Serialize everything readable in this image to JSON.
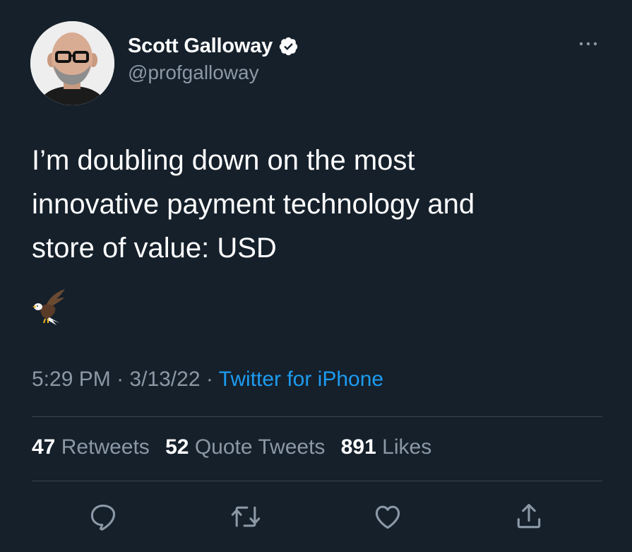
{
  "author": {
    "display_name": "Scott Galloway",
    "handle": "@profgalloway",
    "verified": true,
    "avatar_icon": "person-avatar"
  },
  "tweet": {
    "text": "I’m doubling down on the most\ninnovative payment technology and\nstore of value: USD",
    "emoji": "🦅",
    "emoji_icon": "eagle-icon"
  },
  "meta": {
    "time": "5:29 PM",
    "separator": "·",
    "date": "3/13/22",
    "source": "Twitter for iPhone"
  },
  "stats": {
    "retweets_count": "47",
    "retweets_label": "Retweets",
    "quotes_count": "52",
    "quotes_label": "Quote Tweets",
    "likes_count": "891",
    "likes_label": "Likes"
  },
  "actions": [
    {
      "icon": "reply-icon"
    },
    {
      "icon": "retweet-icon"
    },
    {
      "icon": "like-icon"
    },
    {
      "icon": "share-icon"
    }
  ],
  "colors": {
    "background": "#15202b",
    "primary_text": "#ffffff",
    "secondary_text": "#8b98a5",
    "link": "#1d9bf0",
    "divider": "#38444d"
  }
}
